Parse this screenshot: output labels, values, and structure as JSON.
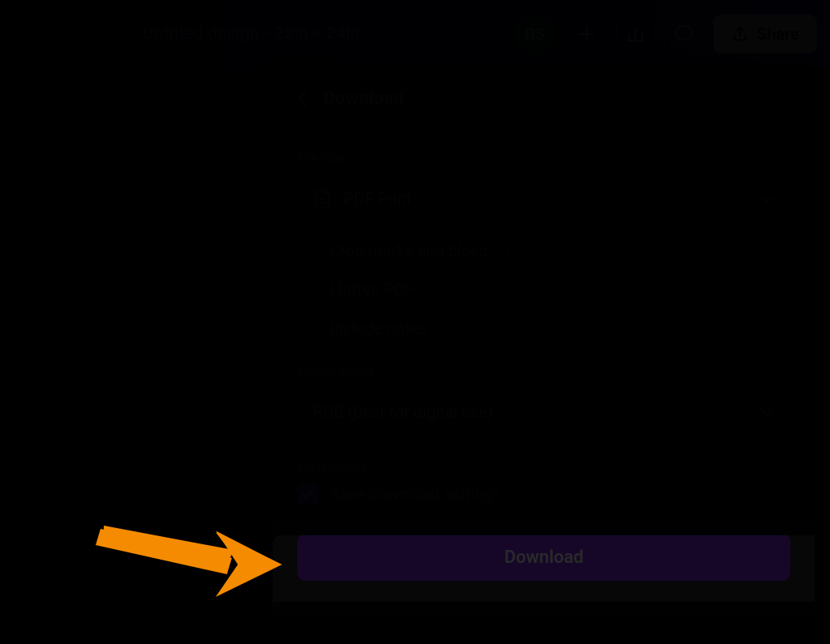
{
  "header": {
    "title": "Untitled design - 22in × 24in",
    "avatar_initials": "RS",
    "share_label": "Share"
  },
  "panel": {
    "title": "Download",
    "file_type_label": "File type",
    "file_type_value": "PDF Print",
    "options": {
      "crop_marks": "Crop marks and bleed",
      "flatten": "Flatten PDF",
      "include_notes": "Include notes"
    },
    "colour_profile_label": "Colour profile",
    "colour_profile_value": "RGB (best for digital use)",
    "preferences_label": "Preferences",
    "save_settings": "Save download settings",
    "download_button": "Download"
  }
}
